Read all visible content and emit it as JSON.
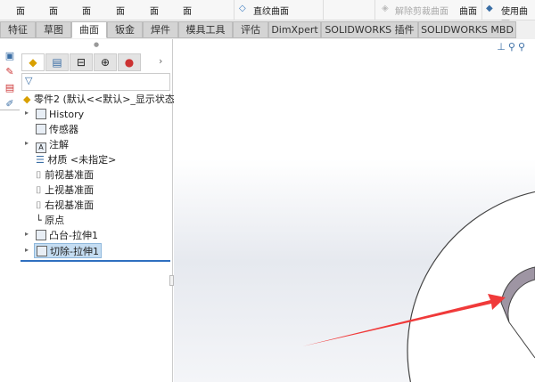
{
  "ribbon": {
    "items": [
      "面",
      "面",
      "面",
      "面",
      "面",
      "面"
    ],
    "ruled_surface": "直纹曲面",
    "untrim": "解除剪裁曲面",
    "surface": "曲面",
    "use_surface": "使用曲面"
  },
  "tabs": [
    {
      "label": "特征"
    },
    {
      "label": "草图"
    },
    {
      "label": "曲面",
      "active": true
    },
    {
      "label": "钣金"
    },
    {
      "label": "焊件"
    },
    {
      "label": "模具工具"
    },
    {
      "label": "评估"
    },
    {
      "label": "DimXpert"
    },
    {
      "label": "SOLIDWORKS 插件"
    },
    {
      "label": "SOLIDWORKS MBD"
    }
  ],
  "tree": {
    "root": "零件2 (默认<<默认>_显示状态",
    "items": [
      {
        "label": "History",
        "expand": true
      },
      {
        "label": "传感器"
      },
      {
        "label": "注解",
        "expand": true
      },
      {
        "label": "材质 <未指定>"
      },
      {
        "label": "前视基准面"
      },
      {
        "label": "上视基准面"
      },
      {
        "label": "右视基准面"
      },
      {
        "label": "原点"
      },
      {
        "label": "凸台-拉伸1",
        "expand": true
      },
      {
        "label": "切除-拉伸1",
        "expand": true,
        "selected": true
      }
    ]
  },
  "colors": {
    "arrow": "#f03a3a",
    "selection": "#c5ddf2"
  }
}
